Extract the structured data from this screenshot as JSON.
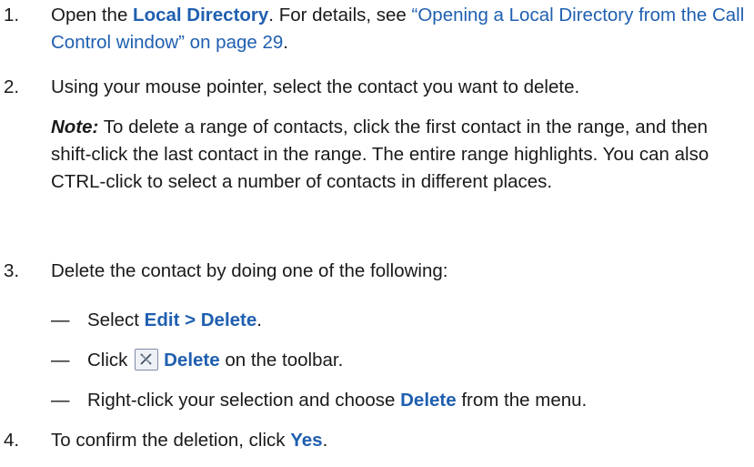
{
  "steps": [
    {
      "number": "1.",
      "text_open": "Open the ",
      "ui_local_directory": "Local Directory",
      "text_details": ". For details, see ",
      "link_text": "“Opening a Local Directory from the Call Control window” on page 29",
      "text_end": "."
    },
    {
      "number": "2.",
      "text": "Using your mouse pointer, select the contact you want to delete.",
      "note_label": "Note:",
      "note_text": " To delete a range of contacts, click the first contact in the range, and then shift-click the last contact in the range. The entire range highlights. You can also CTRL-click to select a number of contacts in different places."
    },
    {
      "number": "3.",
      "text": "Delete the contact by doing one of the following:",
      "options": [
        {
          "dash": "—",
          "pre": "Select ",
          "ui": "Edit > Delete",
          "post": "."
        },
        {
          "dash": "—",
          "pre": "Click ",
          "icon": "delete-x-icon",
          "ui": "Delete",
          "post": " on the toolbar."
        },
        {
          "dash": "—",
          "pre": "Right-click your selection and choose ",
          "ui": "Delete",
          "post": " from the menu."
        }
      ]
    },
    {
      "number": "4.",
      "pre": "To confirm the deletion, click ",
      "ui": "Yes",
      "post": "."
    }
  ],
  "colors": {
    "accent": "#1f5fb0",
    "text": "#1a1a1a"
  }
}
